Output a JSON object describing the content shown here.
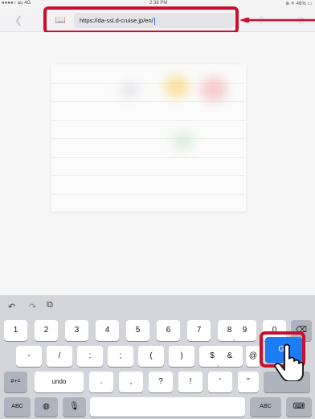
{
  "status": {
    "carrier": "●●●●○ au 4G",
    "time": "2:38 PM",
    "battery": "⊕ ✈ 46% ▭"
  },
  "browser": {
    "url": "https://da-ssl.d-cruise.jp/en/",
    "icons": {
      "back": "chevron-left-icon",
      "bookmarks": "book-icon",
      "share": "share-icon",
      "tabs": "tabs-icon"
    }
  },
  "keyboard": {
    "toolbar": {
      "undo": "undo-icon",
      "redo": "redo-icon",
      "paste": "paste-icon"
    },
    "row1": [
      "1",
      "2",
      "3",
      "4",
      "5",
      "6",
      "7",
      "8",
      "9",
      "0"
    ],
    "delete": "⌫",
    "row2": [
      "-",
      "/",
      ":",
      ";",
      "(",
      ")",
      "$",
      "&",
      "@"
    ],
    "go": "Go",
    "row3": [
      "#+=",
      "undo",
      ".",
      ",",
      "?",
      "!",
      "'",
      "\""
    ],
    "row4": {
      "abc_left": "ABC",
      "globe": "globe-icon",
      "mic": "mic-icon",
      "abc_right": "ABC",
      "hide": "keyboard-hide-icon"
    }
  },
  "colors": {
    "callout": "#c8102e",
    "go": "#1b7cf5",
    "caret": "#2d6df6"
  }
}
